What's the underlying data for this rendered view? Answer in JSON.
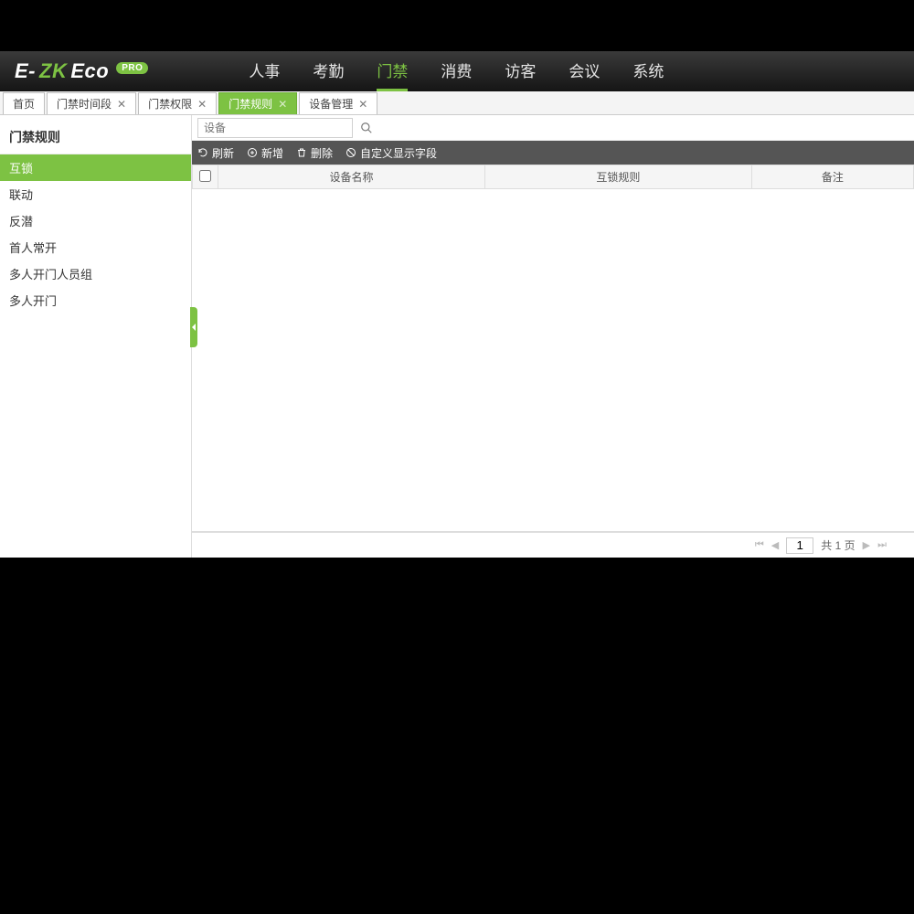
{
  "logo": {
    "pro": "PRO"
  },
  "topnav": [
    {
      "label": "人事",
      "active": false
    },
    {
      "label": "考勤",
      "active": false
    },
    {
      "label": "门禁",
      "active": true
    },
    {
      "label": "消费",
      "active": false
    },
    {
      "label": "访客",
      "active": false
    },
    {
      "label": "会议",
      "active": false
    },
    {
      "label": "系统",
      "active": false
    }
  ],
  "tabs": [
    {
      "label": "首页",
      "closable": false,
      "active": false
    },
    {
      "label": "门禁时间段",
      "closable": true,
      "active": false
    },
    {
      "label": "门禁权限",
      "closable": true,
      "active": false
    },
    {
      "label": "门禁规则",
      "closable": true,
      "active": true
    },
    {
      "label": "设备管理",
      "closable": true,
      "active": false
    }
  ],
  "sidebar": {
    "title": "门禁规则",
    "items": [
      {
        "label": "互锁",
        "active": true
      },
      {
        "label": "联动",
        "active": false
      },
      {
        "label": "反潜",
        "active": false
      },
      {
        "label": "首人常开",
        "active": false
      },
      {
        "label": "多人开门人员组",
        "active": false
      },
      {
        "label": "多人开门",
        "active": false
      }
    ]
  },
  "search": {
    "placeholder": "设备"
  },
  "toolbar": {
    "refresh": "刷新",
    "add": "新增",
    "delete": "删除",
    "columns": "自定义显示字段"
  },
  "grid": {
    "columns": [
      "设备名称",
      "互锁规则",
      "备注"
    ]
  },
  "pager": {
    "page": "1",
    "total_prefix": "共",
    "total_pages": "1",
    "total_suffix": "页"
  }
}
